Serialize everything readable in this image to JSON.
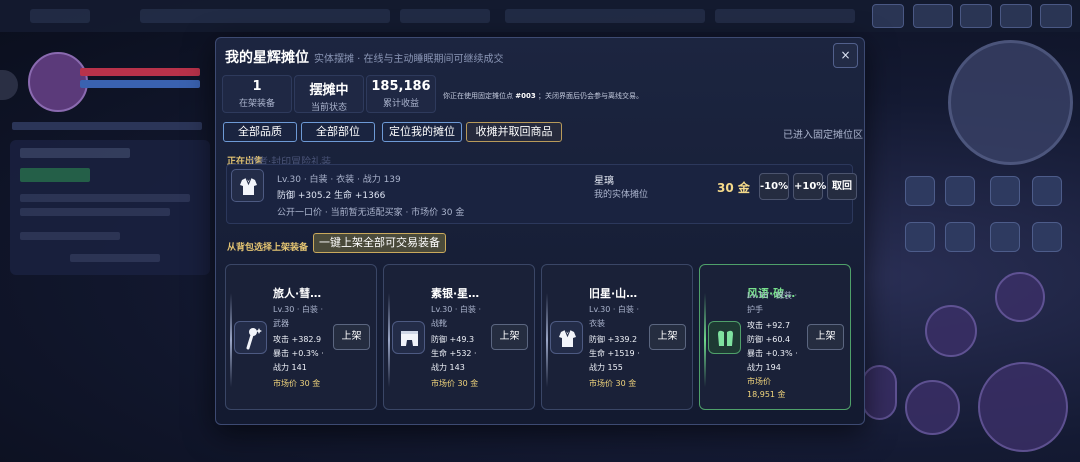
{
  "modal": {
    "title": "我的星辉摊位",
    "subtitle": "实体摆摊 · 在线与主动睡眠期间可继续成交",
    "close_label": "×"
  },
  "stats": [
    {
      "value": "1",
      "label": "在架装备"
    },
    {
      "value": "摆摊中",
      "label": "当前状态"
    },
    {
      "value": "185,186",
      "label": "累计收益"
    }
  ],
  "notice": {
    "prefix": "你正在使用固定摊位点",
    "stall_id": "#003",
    "suffix": "；关闭界面后仍会参与离线交易。"
  },
  "filters": {
    "quality": "全部品质",
    "slot": "全部部位",
    "locate": "定位我的摊位",
    "close_stall": "收摊并取回商品",
    "status": "已进入固定摊位区"
  },
  "on_sale": {
    "label": "正在出售",
    "hint": "旅者·封印冒险礼装",
    "item": {
      "icon": "armor-icon",
      "line1": "Lv.30 · 白装 · 衣装 · 战力 139",
      "line2": "防御 +305.2   生命 +1366",
      "line3": "公开一口价 · 当前暂无适配买家 · 市场价 30 金",
      "owner": "星璃",
      "stall": "我的实体摊位",
      "price": "30 金",
      "minus_label": "-10%",
      "plus_label": "+10%",
      "recall_label": "取回"
    }
  },
  "backpack": {
    "label": "从背包选择上架装备",
    "bulk_label": "一键上架全部可交易装备",
    "items": [
      {
        "name": "旅人·彗…",
        "tag": "Lv.30 · 白装 ·",
        "slot": "武器",
        "stat1": "攻击 +382.9",
        "stat2": "暴击 +0.3% ·",
        "power": "战力 141",
        "market": "市场价 30 金",
        "market2": "",
        "icon": "wand-icon",
        "btn": "上架",
        "rarity": "white"
      },
      {
        "name": "素银·星…",
        "tag": "Lv.30 · 白装 ·",
        "slot": "战靴",
        "stat1": "防御 +49.3",
        "stat2": "生命 +532 ·",
        "power": "战力 143",
        "market": "市场价 30 金",
        "market2": "",
        "icon": "boots-icon",
        "btn": "上架",
        "rarity": "white"
      },
      {
        "name": "旧星·山…",
        "tag": "Lv.30 · 白装 ·",
        "slot": "衣装",
        "stat1": "防御 +339.2",
        "stat2": "生命 +1519 ·",
        "power": "战力 155",
        "market": "市场价 30 金",
        "market2": "",
        "icon": "armor-icon",
        "btn": "上架",
        "rarity": "white"
      },
      {
        "name": "风语·破…",
        "tag": "Lv.30 · 绿装 ·",
        "slot": "护手",
        "stat1": "攻击 +92.7",
        "stat2": "防御 +60.4",
        "stat3": "暴击 +0.3% ·",
        "power": "战力 194",
        "market": "市场价",
        "market2": "18,951 金",
        "icon": "gloves-icon",
        "btn": "上架",
        "rarity": "green"
      }
    ]
  }
}
